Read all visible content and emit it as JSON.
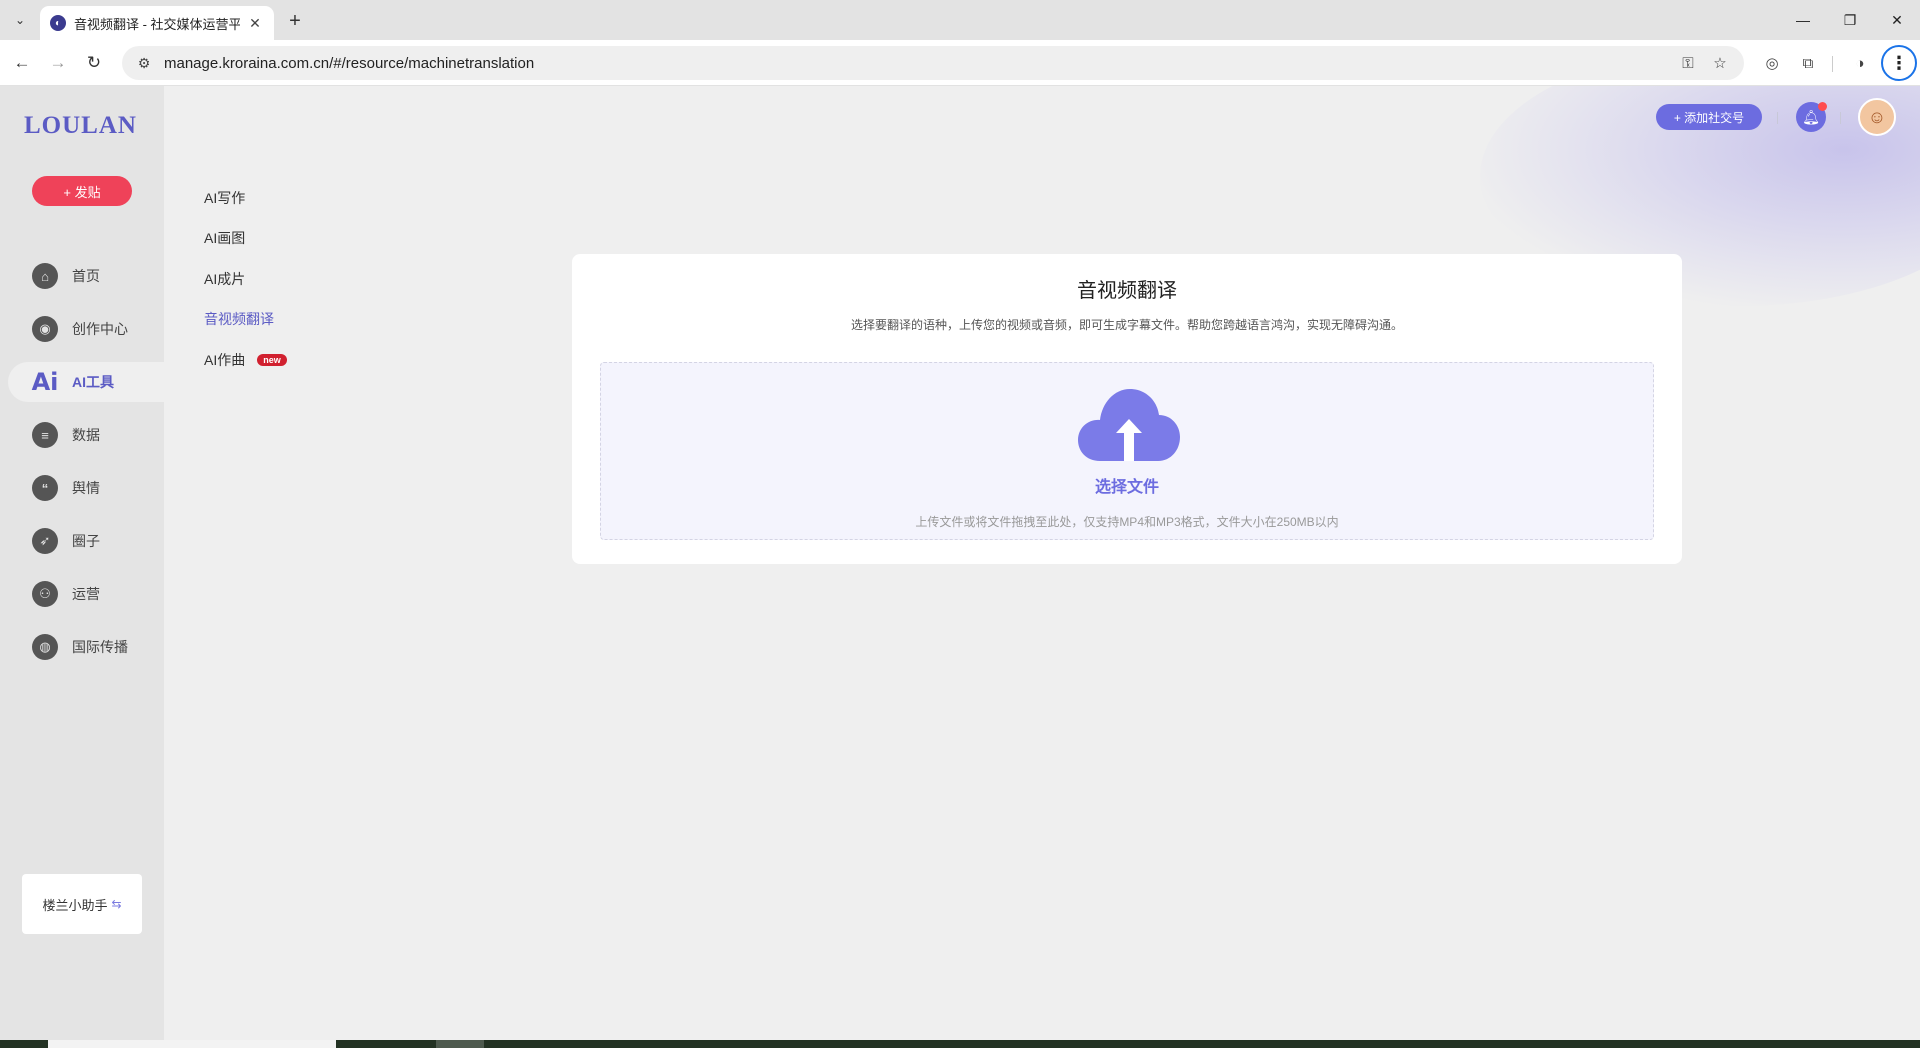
{
  "browser": {
    "tab_title": "音视频翻译 - 社交媒体运营平台",
    "url": "manage.kroraina.com.cn/#/resource/machinetranslation"
  },
  "sidebar": {
    "logo": "LOULAN",
    "post_label": "+ 发贴",
    "items": [
      {
        "label": "首页",
        "icon": "home-icon"
      },
      {
        "label": "创作中心",
        "icon": "palette-icon"
      },
      {
        "label": "AI工具",
        "icon": "ai-icon",
        "active": true
      },
      {
        "label": "数据",
        "icon": "database-icon"
      },
      {
        "label": "舆情",
        "icon": "quote-icon"
      },
      {
        "label": "圈子",
        "icon": "compass-icon"
      },
      {
        "label": "运营",
        "icon": "network-icon"
      },
      {
        "label": "国际传播",
        "icon": "globe-icon"
      }
    ],
    "helper_label": "楼兰小助手"
  },
  "subnav": {
    "items": [
      {
        "label": "AI写作"
      },
      {
        "label": "AI画图"
      },
      {
        "label": "AI成片"
      },
      {
        "label": "音视频翻译",
        "active": true
      },
      {
        "label": "AI作曲",
        "badge": "new"
      }
    ]
  },
  "header": {
    "add_social_label": "+ 添加社交号"
  },
  "main": {
    "title": "音视频翻译",
    "description": "选择要翻译的语种，上传您的视频或音频，即可生成字幕文件。帮助您跨越语言鸿沟，实现无障碍沟通。",
    "upload_label": "选择文件",
    "upload_hint": "上传文件或将文件拖拽至此处，仅支持MP4和MP3格式，文件大小在250MB以内"
  },
  "colors": {
    "accent": "#6c6ce0",
    "post_button": "#ef4259",
    "badge": "#d1202f"
  }
}
